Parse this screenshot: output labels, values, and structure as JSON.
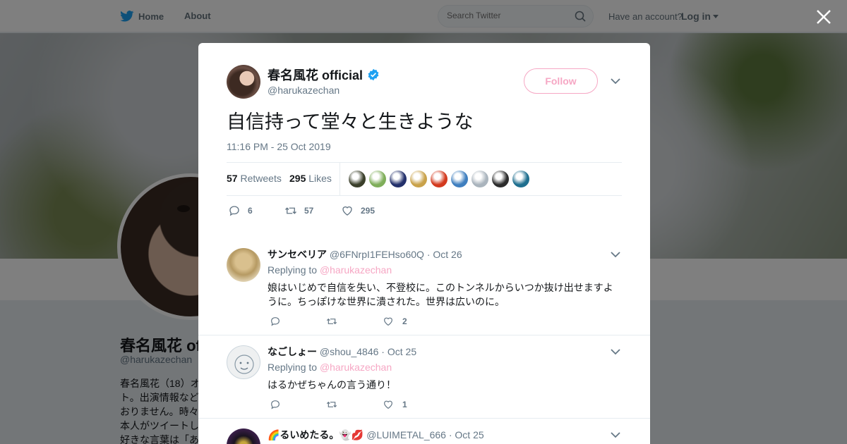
{
  "nav": {
    "home": "Home",
    "about": "About",
    "search_placeholder": "Search Twitter",
    "have_account": "Have an account?",
    "login": "Log in"
  },
  "profile": {
    "name": "春名風花 official",
    "name_truncated": "春名風花 of",
    "handle": "@harukazechan",
    "bio": "春名風花（18）オト。出演情報などおりません。時々本人がツイートし好きな言葉は「あ"
  },
  "tweet": {
    "author_name": "春名風花 official",
    "author_handle": "@harukazechan",
    "follow_label": "Follow",
    "text": "自信持って堂々と生きような",
    "timestamp": "11:16 PM - 25 Oct 2019",
    "retweets_count": "57",
    "retweets_label": "Retweets",
    "likes_count": "295",
    "likes_label": "Likes",
    "reply_count": "6",
    "retweet_count_action": "57",
    "like_count_action": "295",
    "liker_colors": [
      "#3a3f2a",
      "#7fae5a",
      "#23306b",
      "#c9a24a",
      "#d33a1e",
      "#3f7fbf",
      "#aab4bd",
      "#2c2c2c",
      "#1f6f8f"
    ]
  },
  "replies": [
    {
      "name": "サンセベリア",
      "handle": "@6FNrpI1FEHso60Q",
      "date": "Oct 26",
      "replying_prefix": "Replying to",
      "replying_to": "@harukazechan",
      "text": "娘はいじめで自信を失い、不登校に。このトンネルからいつか抜け出せますように。ちっぽけな世界に潰された。世界は広いのに。",
      "likes": "2"
    },
    {
      "name": "なごしょー",
      "handle": "@shou_4846",
      "date": "Oct 25",
      "replying_prefix": "Replying to",
      "replying_to": "@harukazechan",
      "text": "はるかぜちゃんの言う通り！",
      "likes": "1"
    },
    {
      "name": "🌈るいめたる。👻💋",
      "handle": "@LUIMETAL_666",
      "date": "Oct 25"
    }
  ],
  "colors": {
    "accent_pink": "#f6a7c4",
    "verified_blue": "#1da1f2",
    "twitter_blue": "#1da1f2"
  }
}
